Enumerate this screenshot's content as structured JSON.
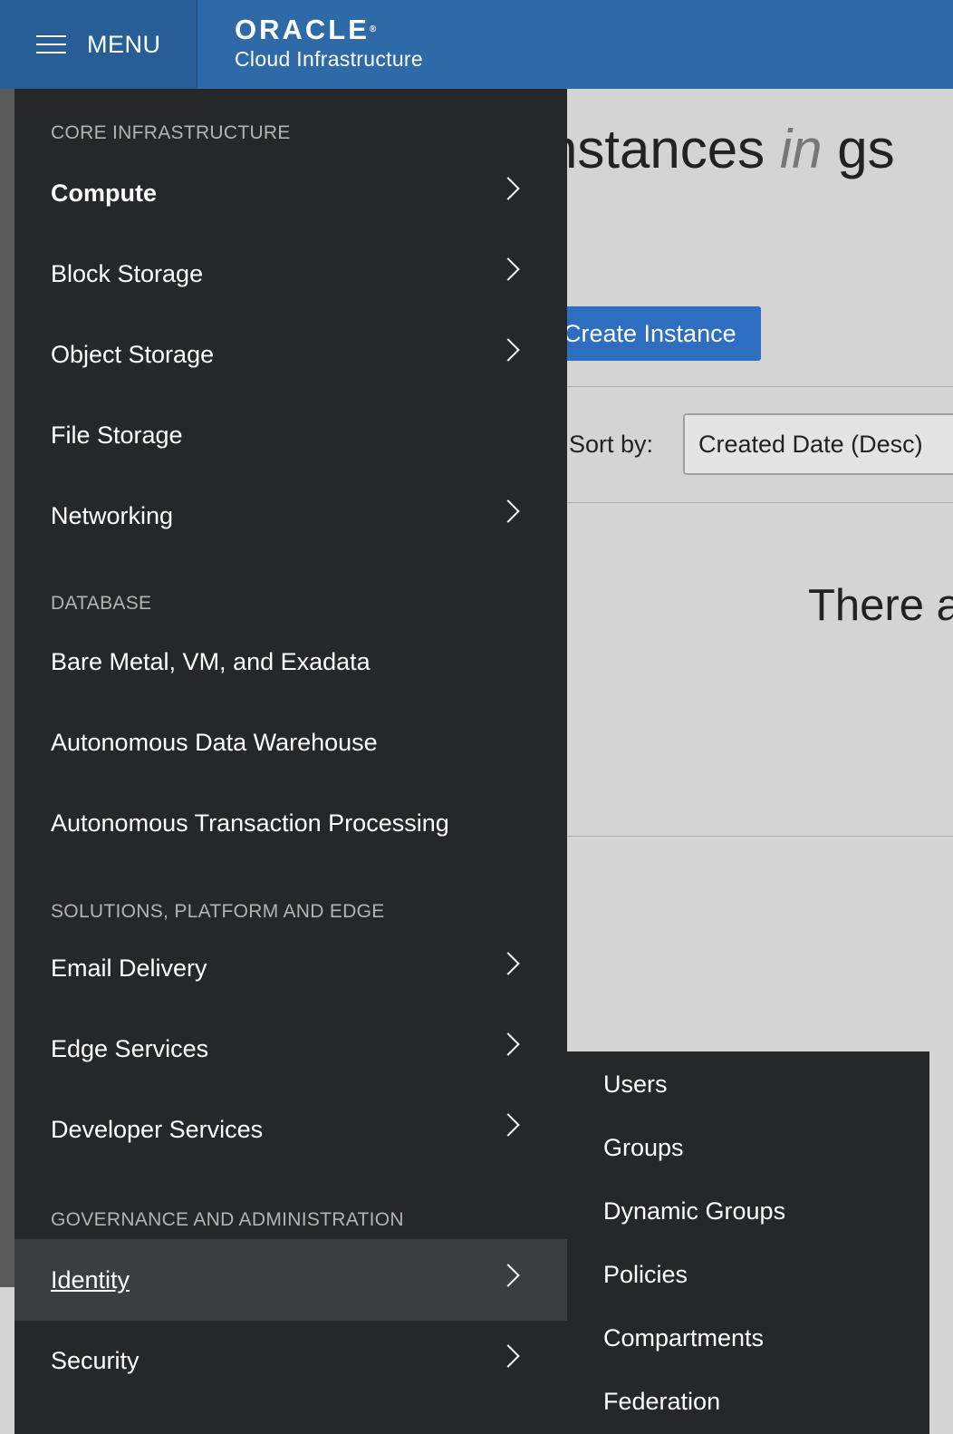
{
  "header": {
    "menu_label": "MENU",
    "brand_name": "ORACLE",
    "brand_mark": "®",
    "brand_sub": "Cloud Infrastructure"
  },
  "page": {
    "title_prefix": "nstances",
    "title_in": "in",
    "title_suffix": "gs",
    "create_button": "Create Instance",
    "sort_label": "Sort by:",
    "sort_value": "Created Date (Desc)",
    "empty_text": "There a"
  },
  "drawer": {
    "sections": [
      "CORE INFRASTRUCTURE",
      "DATABASE",
      "SOLUTIONS, PLATFORM AND EDGE",
      "GOVERNANCE AND ADMINISTRATION"
    ],
    "items": [
      {
        "label": "Compute"
      },
      {
        "label": "Block Storage"
      },
      {
        "label": "Object Storage"
      },
      {
        "label": "File Storage"
      },
      {
        "label": "Networking"
      },
      {
        "label": "Bare Metal, VM, and Exadata"
      },
      {
        "label": "Autonomous Data Warehouse"
      },
      {
        "label": "Autonomous Transaction Processing"
      },
      {
        "label": "Email Delivery"
      },
      {
        "label": "Edge Services"
      },
      {
        "label": "Developer Services"
      },
      {
        "label": "Identity"
      },
      {
        "label": "Security"
      }
    ]
  },
  "submenu": {
    "items": [
      "Users",
      "Groups",
      "Dynamic Groups",
      "Policies",
      "Compartments",
      "Federation"
    ]
  },
  "colors": {
    "header_blue": "#2e6aa8",
    "drawer_dark": "#252728",
    "active_item": "#3b3d40",
    "button_blue": "#2e6ec0"
  }
}
